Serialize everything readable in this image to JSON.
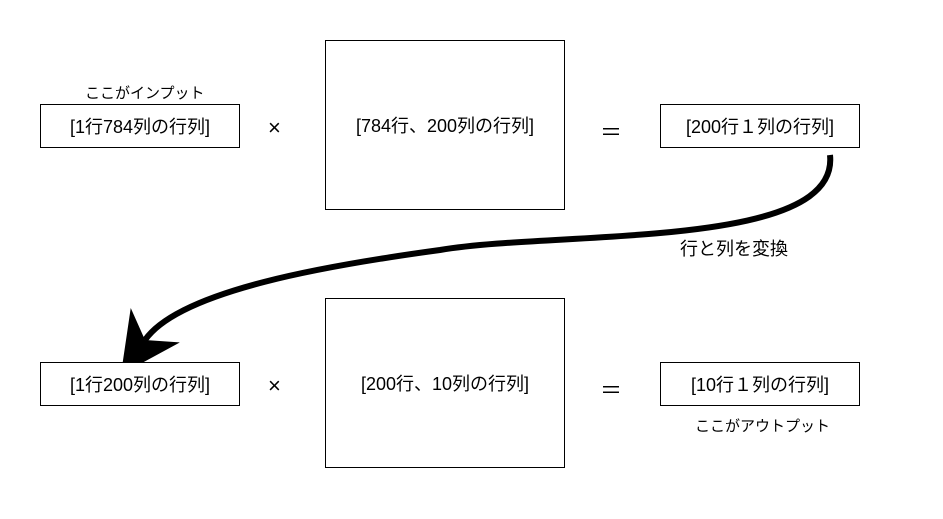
{
  "row1": {
    "input_label": "ここがインプット",
    "left": "[1行784列の行列]",
    "times": "×",
    "center": "[784行、200列の行列]",
    "equals": "＝",
    "right": "[200行１列の行列]"
  },
  "convert_label": "行と列を変換",
  "row2": {
    "left": "[1行200列の行列]",
    "times": "×",
    "center": "[200行、10列の行列]",
    "equals": "＝",
    "right": "[10行１列の行列]",
    "output_label": "ここがアウトプット"
  }
}
